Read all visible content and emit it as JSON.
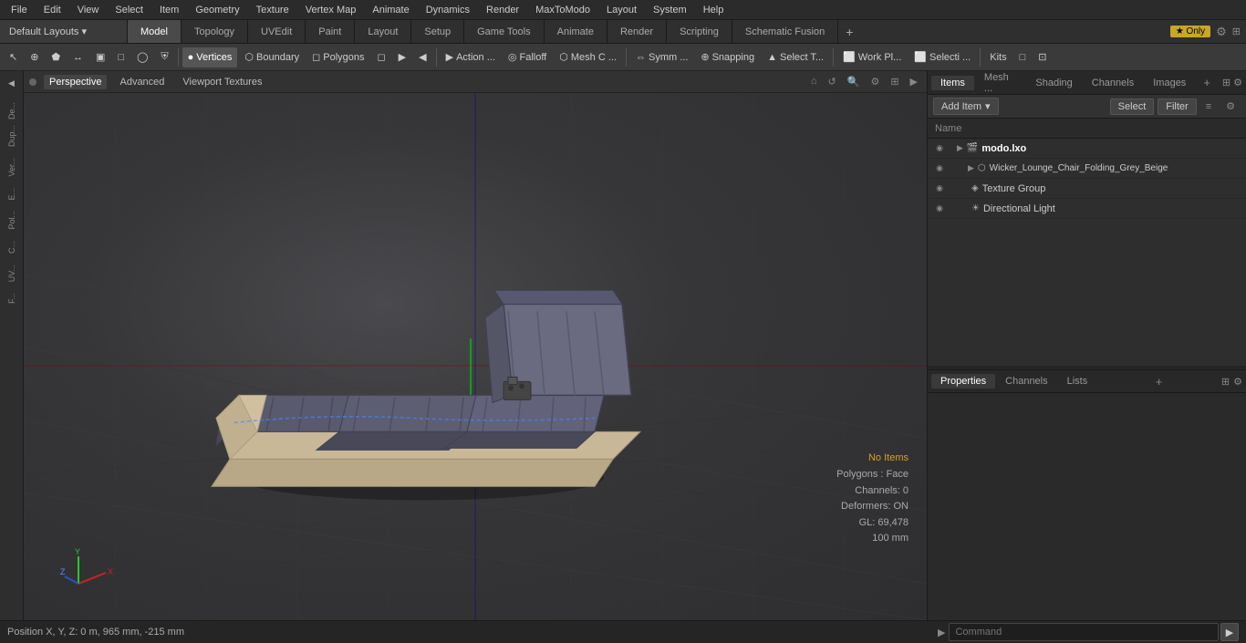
{
  "menubar": {
    "items": [
      "File",
      "Edit",
      "View",
      "Select",
      "Item",
      "Geometry",
      "Texture",
      "Vertex Map",
      "Animate",
      "Dynamics",
      "Render",
      "MaxToModo",
      "Layout",
      "System",
      "Help"
    ]
  },
  "layout_bar": {
    "dropdown": "Default Layouts ▾",
    "tabs": [
      "Model",
      "Topology",
      "UVEdit",
      "Paint",
      "Layout",
      "Setup",
      "Game Tools",
      "Animate",
      "Render",
      "Scripting",
      "Schematic Fusion"
    ],
    "active_tab": "Model",
    "add_label": "+",
    "star_label": "★ Only"
  },
  "toolbar": {
    "viewport_type": "Perspective",
    "buttons": [
      {
        "label": "Vertices",
        "icon": "●"
      },
      {
        "label": "Boundary",
        "icon": "⬡"
      },
      {
        "label": "Polygons",
        "icon": "◻"
      },
      {
        "label": "◻",
        "icon": ""
      },
      {
        "label": "▶",
        "icon": ""
      },
      {
        "label": "◀",
        "icon": ""
      }
    ],
    "action_label": "Action ...",
    "falloff_label": "Falloff",
    "mesh_label": "Mesh C ...",
    "symm_label": "Symm ...",
    "snapping_label": "Snapping",
    "select_label": "Select T...",
    "workplane_label": "Work Pl...",
    "selecti_label": "Selecti ...",
    "kits_label": "Kits"
  },
  "viewport": {
    "dot_color": "#666",
    "tabs": [
      "Perspective",
      "Advanced",
      "Viewport Textures"
    ],
    "active_tab": "Perspective"
  },
  "scene_status": {
    "no_items": "No Items",
    "polygons": "Polygons : Face",
    "channels": "Channels: 0",
    "deformers": "Deformers: ON",
    "gl": "GL: 69,478",
    "size": "100 mm"
  },
  "right_panel": {
    "tabs": [
      "Items",
      "Mesh ...",
      "Shading",
      "Channels",
      "Images"
    ],
    "active_tab": "Items",
    "add_item_label": "Add Item",
    "select_label": "Select",
    "filter_label": "Filter",
    "name_header": "Name",
    "items": [
      {
        "id": "root",
        "name": "modo.lxo",
        "indent": 0,
        "type": "scene",
        "expand": true
      },
      {
        "id": "mesh",
        "name": "Wicker_Lounge_Chair_Folding_Grey_Beige",
        "indent": 2,
        "type": "mesh",
        "expand": false
      },
      {
        "id": "texgrp",
        "name": "Texture Group",
        "indent": 2,
        "type": "texture",
        "expand": false
      },
      {
        "id": "light",
        "name": "Directional Light",
        "indent": 2,
        "type": "light",
        "expand": false
      }
    ]
  },
  "bottom_panel": {
    "tabs": [
      "Properties",
      "Channels",
      "Lists"
    ],
    "active_tab": "Properties",
    "add_tab": "+"
  },
  "status_bar": {
    "position": "Position X, Y, Z:  0 m, 965 mm, -215 mm",
    "command_placeholder": "Command",
    "arrow": "▶"
  }
}
